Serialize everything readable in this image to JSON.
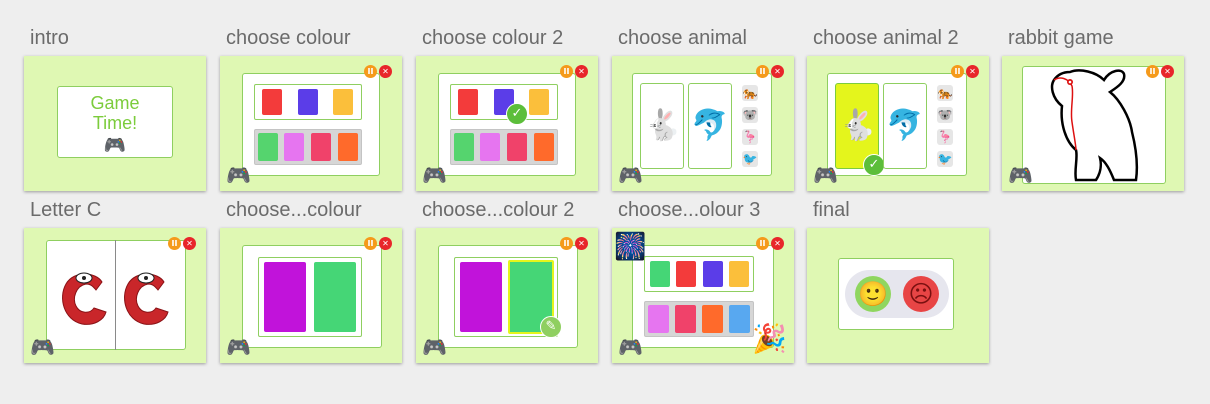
{
  "slides": [
    {
      "label": "intro",
      "title_line1": "Game",
      "title_line2": "Time!"
    },
    {
      "label": "choose colour"
    },
    {
      "label": "choose colour 2"
    },
    {
      "label": "choose animal"
    },
    {
      "label": "choose animal 2"
    },
    {
      "label": "rabbit game"
    },
    {
      "label": "Letter C"
    },
    {
      "label": "choose...colour"
    },
    {
      "label": "choose...colour 2"
    },
    {
      "label": "choose...olour 3"
    },
    {
      "label": "final"
    }
  ],
  "icons": {
    "gamepad": "🎮",
    "pause": "II",
    "close": "✕",
    "check": "✓",
    "pencil": "✎",
    "rabbit": "🐇",
    "dolphin": "🐬",
    "tiger": "🐅",
    "koala": "🐨",
    "flamingo": "🦩",
    "bird": "🐦",
    "fireworks": "🎆",
    "party_popper": "🎉",
    "happy_face": "🙂",
    "sad_face": "☹"
  },
  "colors": {
    "red": "#f33b3b",
    "blue": "#5b3de8",
    "yellow": "#fbbf3b",
    "green": "#55d46e",
    "pink": "#e675f0",
    "magenta": "#f0426a",
    "orange": "#ff6a2b",
    "purple": "#c113da",
    "sky": "#58a8f0",
    "thumb_bg": "#dff8b3",
    "accent_green": "#8fcf60"
  }
}
